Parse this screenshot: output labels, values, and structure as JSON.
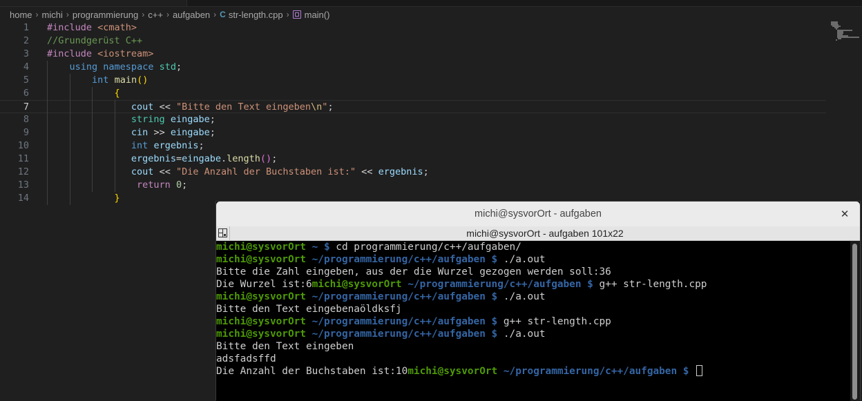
{
  "breadcrumb": {
    "items": [
      "home",
      "michi",
      "programmierung",
      "c++",
      "aufgaben"
    ],
    "file_icon": "C",
    "file": "str-length.cpp",
    "symbol": "main()"
  },
  "editor": {
    "line_numbers": [
      "1",
      "2",
      "3",
      "4",
      "5",
      "6",
      "7",
      "8",
      "9",
      "10",
      "11",
      "12",
      "13",
      "14"
    ],
    "current_line": 7,
    "lines": [
      [
        {
          "t": "#include ",
          "c": "pp"
        },
        {
          "t": "<cmath>",
          "c": "inc"
        }
      ],
      [
        {
          "t": "//Grundgerüst C++",
          "c": "cm"
        }
      ],
      [
        {
          "t": "#include ",
          "c": "pp"
        },
        {
          "t": "<iostream>",
          "c": "inc"
        }
      ],
      [
        {
          "t": "    "
        },
        {
          "t": "using",
          "c": "kw"
        },
        {
          "t": " "
        },
        {
          "t": "namespace",
          "c": "kw"
        },
        {
          "t": " "
        },
        {
          "t": "std",
          "c": "ns"
        },
        {
          "t": ";"
        }
      ],
      [
        {
          "t": "        "
        },
        {
          "t": "int",
          "c": "kw"
        },
        {
          "t": " "
        },
        {
          "t": "main",
          "c": "fn"
        },
        {
          "t": "()",
          "c": "br1"
        }
      ],
      [
        {
          "t": "            "
        },
        {
          "t": "{",
          "c": "br1"
        }
      ],
      [
        {
          "t": "               "
        },
        {
          "t": "cout",
          "c": "var"
        },
        {
          "t": " << ",
          "c": "op"
        },
        {
          "t": "\"Bitte den Text eingeben",
          "c": "str"
        },
        {
          "t": "\\n",
          "c": "esc"
        },
        {
          "t": "\"",
          "c": "str"
        },
        {
          "t": ";"
        }
      ],
      [
        {
          "t": "               "
        },
        {
          "t": "string",
          "c": "ns"
        },
        {
          "t": " "
        },
        {
          "t": "eingabe",
          "c": "var"
        },
        {
          "t": ";"
        }
      ],
      [
        {
          "t": "               "
        },
        {
          "t": "cin",
          "c": "var"
        },
        {
          "t": " >> ",
          "c": "op"
        },
        {
          "t": "eingabe",
          "c": "var"
        },
        {
          "t": ";"
        }
      ],
      [
        {
          "t": "               "
        },
        {
          "t": "int",
          "c": "kw"
        },
        {
          "t": " "
        },
        {
          "t": "ergebnis",
          "c": "var"
        },
        {
          "t": ";"
        }
      ],
      [
        {
          "t": "               "
        },
        {
          "t": "ergebnis",
          "c": "var"
        },
        {
          "t": "=",
          "c": "op"
        },
        {
          "t": "eingabe",
          "c": "var"
        },
        {
          "t": "."
        },
        {
          "t": "length",
          "c": "fn"
        },
        {
          "t": "()",
          "c": "br2"
        },
        {
          "t": ";"
        }
      ],
      [
        {
          "t": "               "
        },
        {
          "t": "cout",
          "c": "var"
        },
        {
          "t": " << ",
          "c": "op"
        },
        {
          "t": "\"Die Anzahl der Buchstaben ist:\"",
          "c": "str"
        },
        {
          "t": " << ",
          "c": "op"
        },
        {
          "t": "ergebnis",
          "c": "var"
        },
        {
          "t": ";"
        }
      ],
      [
        {
          "t": "                "
        },
        {
          "t": "return",
          "c": "ret"
        },
        {
          "t": " "
        },
        {
          "t": "0",
          "c": "num"
        },
        {
          "t": ";"
        }
      ],
      [
        {
          "t": "            "
        },
        {
          "t": "}",
          "c": "br1"
        }
      ]
    ]
  },
  "terminal": {
    "title": "michi@sysvorOrt - aufgaben",
    "close_glyph": "✕",
    "tab_label": "michi@sysvorOrt - aufgaben 101x22",
    "lines": [
      [
        {
          "t": "michi@sysvorOrt",
          "c": "user"
        },
        {
          "t": " ~ $",
          "c": "path"
        },
        {
          "t": " cd programmierung/c++/aufgaben/"
        }
      ],
      [
        {
          "t": "michi@sysvorOrt",
          "c": "user"
        },
        {
          "t": " ~/programmierung/c++/aufgaben $",
          "c": "path"
        },
        {
          "t": " ./a.out"
        }
      ],
      [
        {
          "t": "Bitte die Zahl eingeben, aus der die Wurzel gezogen werden soll:36"
        }
      ],
      [
        {
          "t": "Die Wurzel ist:6"
        },
        {
          "t": "michi@sysvorOrt",
          "c": "user"
        },
        {
          "t": " ~/programmierung/c++/aufgaben $",
          "c": "path"
        },
        {
          "t": " g++ str-length.cpp"
        }
      ],
      [
        {
          "t": "michi@sysvorOrt",
          "c": "user"
        },
        {
          "t": " ~/programmierung/c++/aufgaben $",
          "c": "path"
        },
        {
          "t": " ./a.out"
        }
      ],
      [
        {
          "t": "Bitte den Text eingebenaöldksfj"
        }
      ],
      [
        {
          "t": "michi@sysvorOrt",
          "c": "user"
        },
        {
          "t": " ~/programmierung/c++/aufgaben $",
          "c": "path"
        },
        {
          "t": " g++ str-length.cpp"
        }
      ],
      [
        {
          "t": "michi@sysvorOrt",
          "c": "user"
        },
        {
          "t": " ~/programmierung/c++/aufgaben $",
          "c": "path"
        },
        {
          "t": " ./a.out"
        }
      ],
      [
        {
          "t": "Bitte den Text eingeben"
        }
      ],
      [
        {
          "t": "adsfadsffd"
        }
      ],
      [
        {
          "t": "Die Anzahl der Buchstaben ist:10"
        },
        {
          "t": "michi@sysvorOrt",
          "c": "user"
        },
        {
          "t": " ~/programmierung/c++/aufgaben $",
          "c": "path"
        },
        {
          "t": " "
        }
      ]
    ]
  },
  "colors": {
    "editor_bg": "#1f1f1f",
    "keyword": "#569cd6",
    "string": "#ce9178",
    "comment": "#6a9955",
    "prompt_user": "#4e9a06",
    "prompt_path": "#3465a4"
  }
}
